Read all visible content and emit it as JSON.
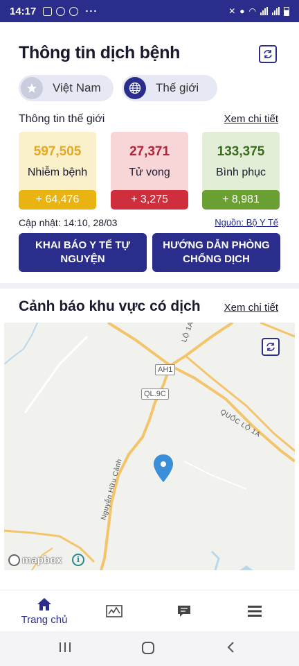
{
  "status_bar": {
    "time": "14:17",
    "dots": "···"
  },
  "header": {
    "title": "Thông tin dịch bệnh",
    "refresh_icon": "refresh-icon"
  },
  "scope_toggle": {
    "vietnam_label": "Việt Nam",
    "world_label": "Thế giới",
    "selected": "Thế giới"
  },
  "world_stats": {
    "section_label": "Thông tin thế giới",
    "details_link": "Xem chi tiết",
    "infected": {
      "value": "597,505",
      "label": "Nhiễm bệnh",
      "delta": "+ 64,476",
      "color": "#e9b312"
    },
    "deaths": {
      "value": "27,371",
      "label": "Tử vong",
      "delta": "+ 3,275",
      "color": "#cf2f3c"
    },
    "recovered": {
      "value": "133,375",
      "label": "Bình phục",
      "delta": "+ 8,981",
      "color": "#6a9f31"
    },
    "updated": "Cập nhật: 14:10, 28/03",
    "source": "Nguồn: Bộ Y Tế"
  },
  "actions": {
    "declare_label": "KHAI BÁO Y TẾ TỰ NGUYỆN",
    "guide_label": "HƯỚNG DẪN PHÒNG CHỐNG DỊCH"
  },
  "alert_section": {
    "title": "Cảnh báo khu vực có dịch",
    "details_link": "Xem chi tiết"
  },
  "map": {
    "labels": {
      "ah1": "AH1",
      "ql9c": "QL.9C",
      "quoc_lo": "QUỐC LỘ 1A",
      "lo1a_top": "LỘ 1A",
      "nguyen_huu_canh": "Nguyễn Hữu Cảnh"
    },
    "attribution": "mapbox",
    "pin_color": "#3a8fd8"
  },
  "tab_bar": {
    "home_label": "Trang chủ",
    "active": "home",
    "accent": "#2b2d8d"
  }
}
